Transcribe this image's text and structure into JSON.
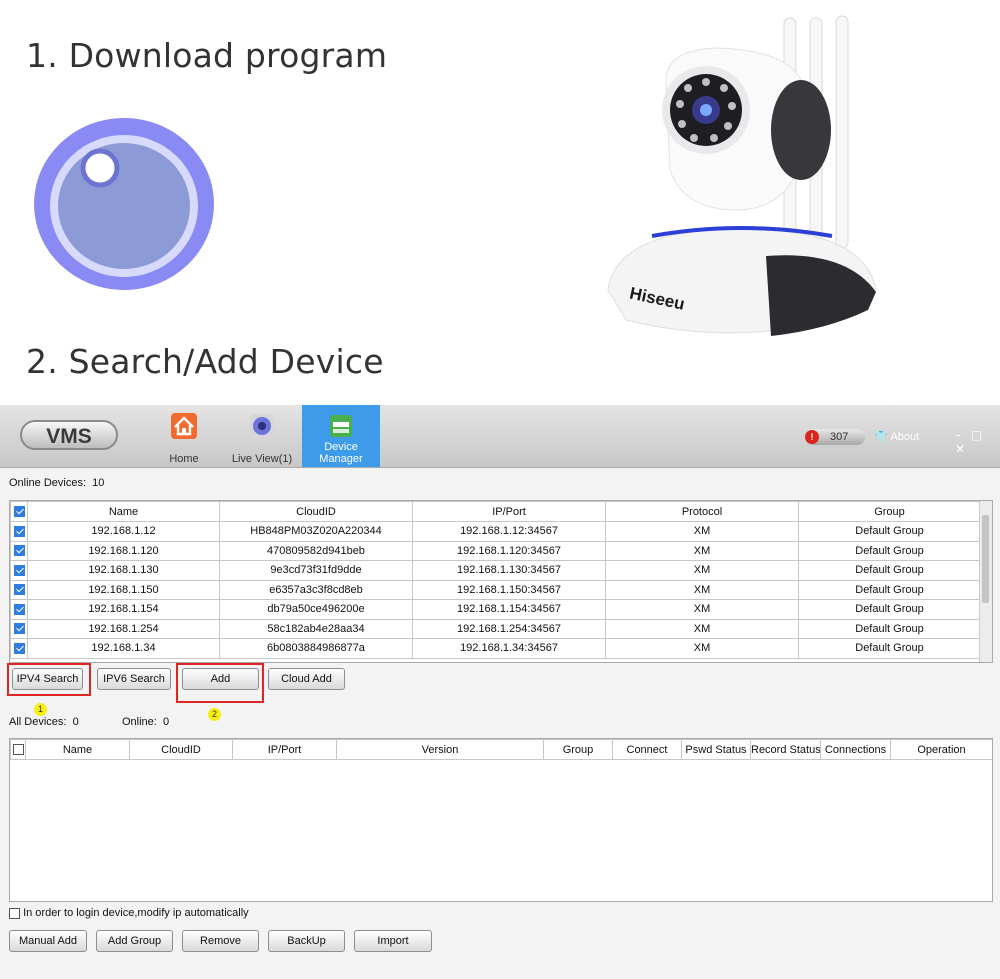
{
  "step1": {
    "title": "1. Download program"
  },
  "step2": {
    "title": "2. Search/Add Device"
  },
  "camera": {
    "brand": "Hiseeu"
  },
  "vms": {
    "logo": "VMS",
    "nav": [
      {
        "label": "Home"
      },
      {
        "label": "Live View(1)"
      },
      {
        "label": "Device Manager"
      }
    ],
    "alarm_count": "307",
    "about": "About",
    "window_controls": "– □ ✕",
    "online_label": "Online Devices:",
    "online_count": "10",
    "online_headers": [
      "Name",
      "CloudID",
      "IP/Port",
      "Protocol",
      "Group"
    ],
    "online_rows": [
      [
        "192.168.1.12",
        "HB848PM03Z020A220344",
        "192.168.1.12:34567",
        "XM",
        "Default Group"
      ],
      [
        "192.168.1.120",
        "470809582d941beb",
        "192.168.1.120:34567",
        "XM",
        "Default Group"
      ],
      [
        "192.168.1.130",
        "9e3cd73f31fd9dde",
        "192.168.1.130:34567",
        "XM",
        "Default Group"
      ],
      [
        "192.168.1.150",
        "e6357a3c3f8cd8eb",
        "192.168.1.150:34567",
        "XM",
        "Default Group"
      ],
      [
        "192.168.1.154",
        "db79a50ce496200e",
        "192.168.1.154:34567",
        "XM",
        "Default Group"
      ],
      [
        "192.168.1.254",
        "58c182ab4e28aa34",
        "192.168.1.254:34567",
        "XM",
        "Default Group"
      ],
      [
        "192.168.1.34",
        "6b0803884986877a",
        "192.168.1.34:34567",
        "XM",
        "Default Group"
      ]
    ],
    "buttons": {
      "ipv4": "IPV4 Search",
      "ipv6": "IPV6 Search",
      "add": "Add",
      "cloud_add": "Cloud Add"
    },
    "markers": {
      "one": "1",
      "two": "2"
    },
    "all_label": "All Devices:",
    "all_count": "0",
    "all_online_label": "Online:",
    "all_online_count": "0",
    "all_headers": [
      "Name",
      "CloudID",
      "IP/Port",
      "Version",
      "Group",
      "Connect",
      "Pswd Status",
      "Record Status",
      "Connections",
      "Operation"
    ],
    "auto_ip_label": "In order to login device,modify ip automatically",
    "bottom_buttons": {
      "manual_add": "Manual Add",
      "add_group": "Add Group",
      "remove": "Remove",
      "backup": "BackUp",
      "import": "Import"
    }
  },
  "colors": {
    "accent": "#3d9be9",
    "highlight": "#e02525",
    "marker": "#f7ef12"
  }
}
